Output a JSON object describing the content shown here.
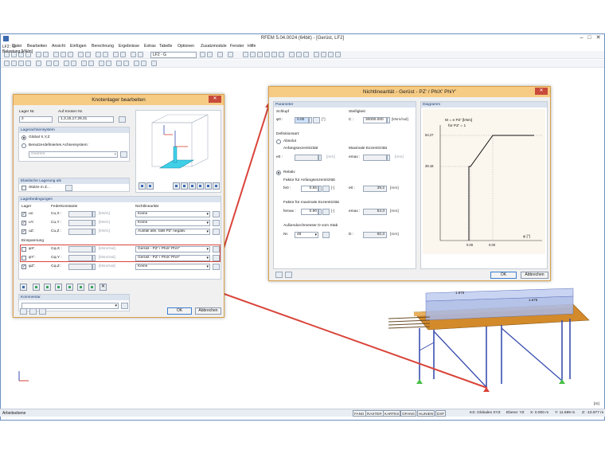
{
  "app": {
    "title": "RFEM 5.04.0024 (64bit) - [Gerüst, LF2]",
    "menu": [
      "Datei",
      "Bearbeiten",
      "Ansicht",
      "Einfügen",
      "Berechnung",
      "Ergebnisse",
      "Extras",
      "Tabelle",
      "Optionen",
      "Zusatzmodule",
      "Fenster",
      "Hilfe"
    ],
    "loadcase_combo": "LF2 - G",
    "nav_line1": "LF2 : G",
    "nav_line2": "Belastung [kN/m]",
    "colors": {
      "accent": "#d9443a",
      "dialog_title": "#f6cb84",
      "frame_blue": "#3a4fb0",
      "deck_orange": "#d38a2a"
    }
  },
  "dialog1": {
    "title": "Knotenlager bearbeiten",
    "lager_nr_label": "Lager Nr.",
    "lager_nr": "2",
    "auf_knoten_label": "Auf Knoten Nr.",
    "auf_knoten": "1,3,15,17,29,31",
    "lagerachsensystem_head": "Lagerachsensystem",
    "global_label": "Global X,Y,Z",
    "benutzer_label": "Benutzerdefiniertes Achsensystem:",
    "gedreht": "Gedreht",
    "elastische_head": "Elastische Lagerung als",
    "stuetze_label": "Stütze in Z...",
    "lagerbedingungen_head": "Lagerbedingungen",
    "col_lager": "Lager",
    "col_feder": "Federkonstante",
    "col_nichtlin": "Nichtlinearität",
    "rows_translation": [
      {
        "name": "ux:",
        "spring": "Cu,X :",
        "unit": "[kN/m]",
        "nonlin": "Keine"
      },
      {
        "name": "uY:",
        "spring": "Cu,Y :",
        "unit": "[kN/m]",
        "nonlin": "Keine"
      },
      {
        "name": "uZ:",
        "spring": "Cu,Z :",
        "unit": "[kN/m]",
        "nonlin": "Ausfall alle, falls PZ' negativ"
      }
    ],
    "einspannung_label": "Einspannung",
    "rows_rotation": [
      {
        "name": "φX':",
        "spring": "Cφ,X :",
        "unit": "[kNm/rad]",
        "nonlin": "Gerüst - PZ' / PhiX' PhiY'"
      },
      {
        "name": "φY':",
        "spring": "Cφ,Y :",
        "unit": "[kNm/rad]",
        "nonlin": "Gerüst - PZ' / PhiX' PhiY'"
      },
      {
        "name": "φZ':",
        "spring": "Cφ,Z :",
        "unit": "[kNm/rad]",
        "nonlin": "Keine"
      }
    ],
    "kommentar_head": "Kommentar",
    "ok": "OK",
    "abbrechen": "Abbrechen"
  },
  "dialog2": {
    "title": "Nichtlinearität - Gerüst - PZ' / PhiX' PhiY'",
    "parameter_head": "Parameter",
    "schlupf_label": "Schlupf",
    "phi0_label": "φ0 :",
    "phi0_value": "0.00",
    "phi0_unit": "[°]",
    "steifigkeit_label": "Steifigkeit",
    "c_label": "C :",
    "c_value": "30000.000",
    "c_unit": "[kNm/rad]",
    "definitionsart_label": "Definitionsart:",
    "absolut_label": "Absolut",
    "anfang_label": "Anfangsexzentrizität",
    "maximale_label": "Maximale Exzentrizität",
    "e0_label": "e0 :",
    "e0_unit": "[mm]",
    "emax_label": "emax :",
    "emax_unit": "[mm]",
    "relativ_label": "Relativ",
    "faktor_anf_label": "Faktor für Anfangsexzentrizität",
    "fe0_label": "fe0 :",
    "fe0_value": "0.65",
    "fe0_unit": "[-]",
    "e0_result": "39.2",
    "e0_result_unit": "[mm]",
    "faktor_max_label": "Faktor für maximale Exzentrizität",
    "femax_label": "femax :",
    "femax_value": "0.90",
    "femax_unit": "[-]",
    "emax_result": "54.3",
    "emax_result_unit": "[mm]",
    "aussen_label": "Außendurchmesser D vom Stab",
    "nr_label": "Nr.",
    "nr_value": "48",
    "d_label": "D :",
    "d_value": "60.3",
    "d_unit": "[mm]",
    "diagramm_head": "Diagramm",
    "diagram_formula": "M = e PZ' [kNm]",
    "diagram_formula2": "für PZ' = 1",
    "y_tick_top": "54.27",
    "y_tick_mid": "39.18",
    "x_tick_1": "0.00",
    "x_tick_2": "0.00",
    "x_axis_label": "φ [°]",
    "ok": "OK",
    "abbrechen": "Abbrechen"
  },
  "model": {
    "dim_1": "1.675",
    "dim_2": "1.675"
  },
  "status": {
    "left": "Arbeitsebene",
    "buttons": [
      "FANG",
      "RASTER",
      "KARTES",
      "OFANG",
      "HLINIEN",
      "DXF"
    ],
    "ks": "KS: Globales XYZ",
    "ebene": "Ebene: YZ",
    "x": "X: 0.000 m",
    "y": "Y: 11.699 m",
    "z": "Z: -10.977 m",
    "m_label": "[m]"
  }
}
